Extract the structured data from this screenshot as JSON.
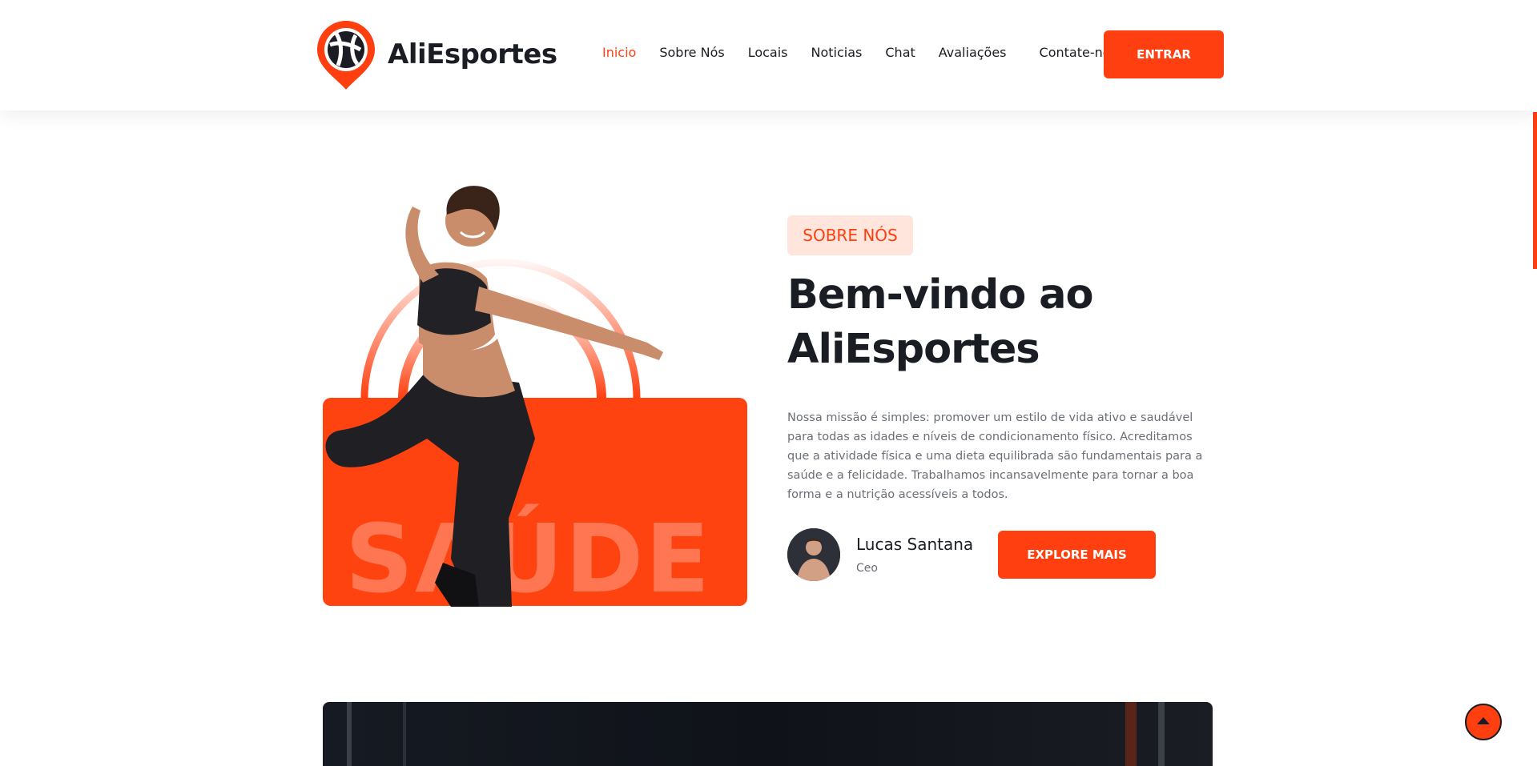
{
  "brand": {
    "name": "AliEsportes",
    "accent_color": "#ff3f0f",
    "logo_icon": "volleyball-pin-icon"
  },
  "nav": {
    "items": [
      {
        "label": "Inicio",
        "active": true
      },
      {
        "label": "Sobre Nós"
      },
      {
        "label": "Locais"
      },
      {
        "label": "Noticias"
      },
      {
        "label": "Chat"
      },
      {
        "label": "Avaliações"
      },
      {
        "label": "Contate-nos"
      }
    ],
    "login_label": "ENTRAR"
  },
  "hero": {
    "tag": "SOBRE NÓS",
    "title_line1": "Bem-vindo ao",
    "title_line2": "AliEsportes",
    "description": "Nossa missão é simples: promover um estilo de vida ativo e saudável para todas as idades e níveis de condicionamento físico. Acreditamos que a atividade física e uma dieta equilibrada são fundamentais para a saúde e a felicidade. Trabalhamos incansavelmente para tornar a boa forma e a nutrição acessíveis a todos.",
    "image_watermark": "SAÚDE",
    "author": {
      "name": "Lucas Santana",
      "role": "Ceo"
    },
    "cta_label": "EXPLORE MAIS"
  },
  "back_to_top_icon": "arrow-up-icon"
}
